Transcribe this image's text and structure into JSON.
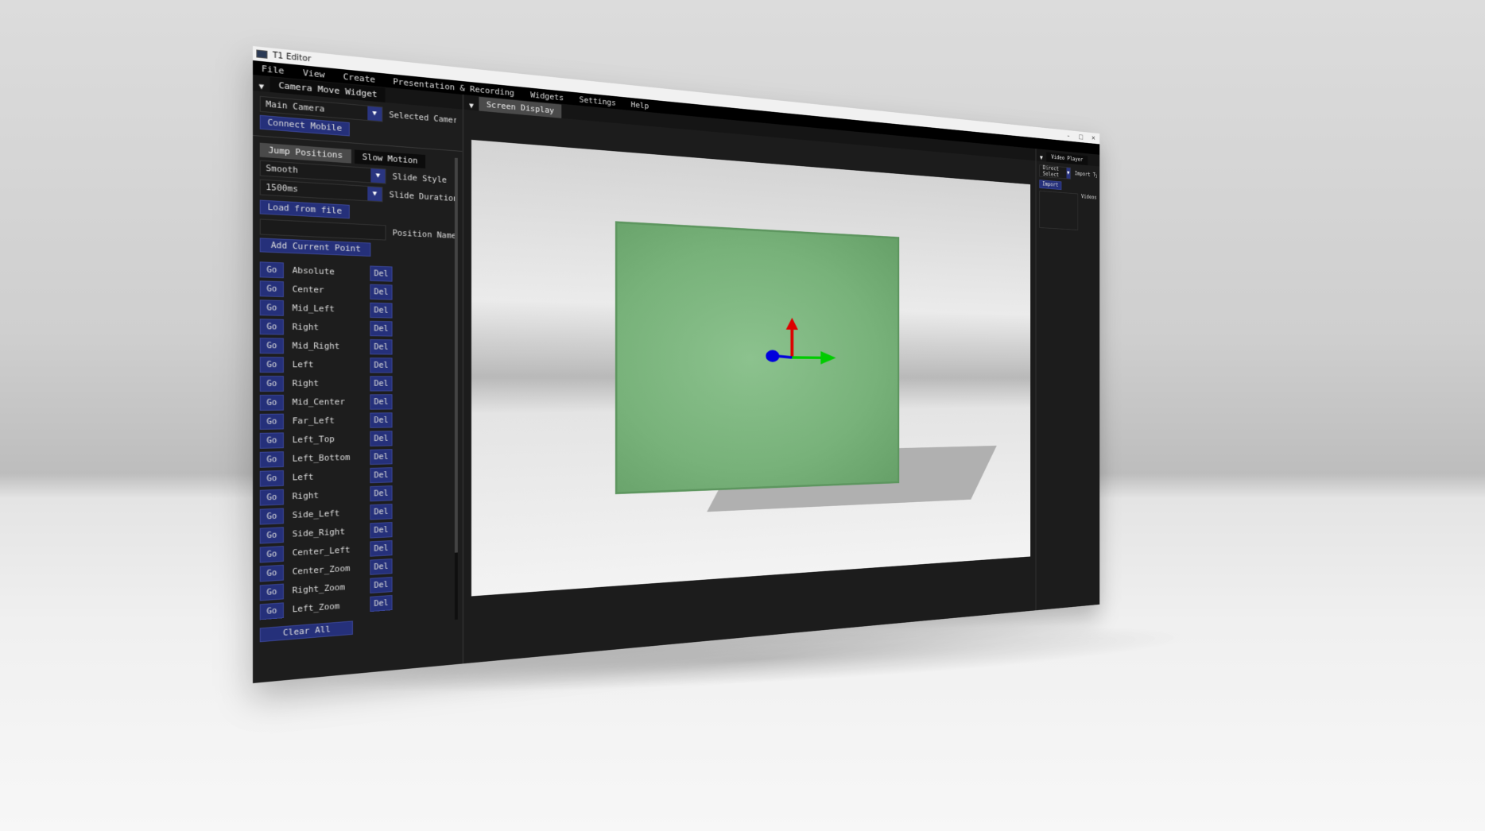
{
  "window": {
    "title": "T1 Editor",
    "controls": {
      "minimize": "–",
      "maximize": "□",
      "close": "✕"
    }
  },
  "menu": [
    "File",
    "View",
    "Create",
    "Presentation & Recording",
    "Widgets",
    "Settings",
    "Help"
  ],
  "left_panel": {
    "tab_title": "Camera Move Widget",
    "camera_select": {
      "value": "Main Camera",
      "label": "Selected Camera"
    },
    "connect_mobile": "Connect Mobile",
    "subtabs": [
      "Jump Positions",
      "Slow Motion"
    ],
    "slide_style": {
      "value": "Smooth",
      "label": "Slide Style"
    },
    "slide_duration": {
      "value": "1500ms",
      "label": "Slide Duration"
    },
    "load_from_file": "Load from file",
    "position_name": {
      "value": "",
      "label": "Position Name"
    },
    "add_current_point": "Add Current Point",
    "go_label": "Go",
    "del_label": "Del",
    "positions": [
      "Absolute",
      "Center",
      "Mid_Left",
      "Right",
      "Mid_Right",
      "Left",
      "Right",
      "Mid_Center",
      "Far_Left",
      "Left_Top",
      "Left_Bottom",
      "Left",
      "Right",
      "Side_Left",
      "Side_Right",
      "Center_Left",
      "Center_Zoom",
      "Right_Zoom",
      "Left_Zoom"
    ],
    "clear_all": "Clear All"
  },
  "center_panel": {
    "tab_title": "Screen Display"
  },
  "right_panel": {
    "tab_title": "Video Player",
    "import_type": {
      "value": "Direct Select",
      "label": "Import Type"
    },
    "import_button": "Import",
    "videos_label": "Videos"
  },
  "colors": {
    "button_blue": "#25307a",
    "gizmo_x": "#00cc00",
    "gizmo_y": "#dd0000",
    "gizmo_z": "#0000dd",
    "plane_green": "#78b27a"
  }
}
